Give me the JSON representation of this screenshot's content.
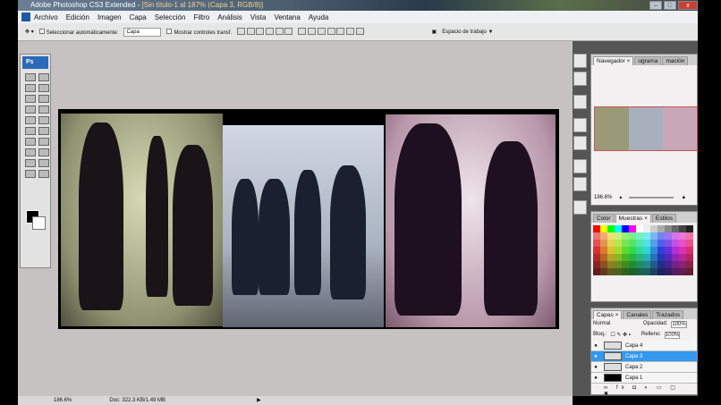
{
  "title": {
    "app": "Adobe Photoshop CS3 Extended",
    "doc": "[Sin título-1 al 187% (Capa 3, RGB/8)]"
  },
  "window_buttons": [
    "–",
    "□",
    "x"
  ],
  "menu": [
    "Archivo",
    "Edición",
    "Imagen",
    "Capa",
    "Selección",
    "Filtro",
    "Análisis",
    "Vista",
    "Ventana",
    "Ayuda"
  ],
  "options": {
    "auto_select": "Seleccionar automáticamente:",
    "auto_select_value": "Capa",
    "show_transform": "Mostrar controles transf.",
    "workspace": "Espacio de trabajo ▼"
  },
  "toolbox": {
    "logo": "Ps"
  },
  "status": {
    "zoom": "186.6%",
    "doc": "Doc: 322.3 KB/1.49 MB"
  },
  "navigator": {
    "tabs": [
      "Navegador ×",
      "ograma",
      "maciòn"
    ],
    "zoom": "186.6%"
  },
  "swatches": {
    "tabs": [
      "Color",
      "Muestras ×",
      "Estilos"
    ]
  },
  "layers": {
    "tabs": [
      "Capas ×",
      "Canales",
      "Trazados"
    ],
    "blend": "Normal",
    "opacity_label": "Opacidad:",
    "opacity": "100%",
    "lock_label": "Bloq.:",
    "fill_label": "Relleno:",
    "fill": "100%",
    "items": [
      {
        "name": "Capa 4",
        "active": false
      },
      {
        "name": "Capa 3",
        "active": true
      },
      {
        "name": "Capa 2",
        "active": false
      },
      {
        "name": "Capa 1",
        "active": false
      }
    ]
  }
}
